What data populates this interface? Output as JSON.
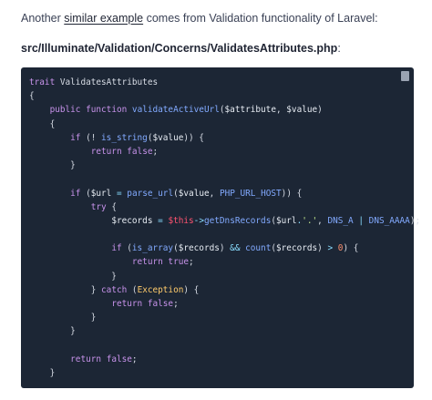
{
  "intro": {
    "before": "Another ",
    "link": "similar example",
    "after": " comes from Validation functionality of Laravel:"
  },
  "file": {
    "path": "src/Illuminate/Validation/Concerns/ValidatesAttributes.php",
    "suffix": ":"
  },
  "code": {
    "lines": [
      [
        [
          "kw",
          "trait"
        ],
        [
          "txt",
          " ValidatesAttributes"
        ]
      ],
      [
        [
          "txt",
          "{"
        ]
      ],
      [
        [
          "txt",
          "    "
        ],
        [
          "kw",
          "public"
        ],
        [
          "txt",
          " "
        ],
        [
          "kw",
          "function"
        ],
        [
          "txt",
          " "
        ],
        [
          "fn",
          "validateActiveUrl"
        ],
        [
          "txt",
          "("
        ],
        [
          "var",
          "$attribute"
        ],
        [
          "txt",
          ", "
        ],
        [
          "var",
          "$value"
        ],
        [
          "txt",
          ")"
        ]
      ],
      [
        [
          "txt",
          "    {"
        ]
      ],
      [
        [
          "txt",
          "        "
        ],
        [
          "kw",
          "if"
        ],
        [
          "txt",
          " (! "
        ],
        [
          "fn",
          "is_string"
        ],
        [
          "txt",
          "("
        ],
        [
          "var",
          "$value"
        ],
        [
          "txt",
          ")) {"
        ]
      ],
      [
        [
          "txt",
          "            "
        ],
        [
          "kw",
          "return"
        ],
        [
          "txt",
          " "
        ],
        [
          "kw",
          "false"
        ],
        [
          "txt",
          ";"
        ]
      ],
      [
        [
          "txt",
          "        }"
        ]
      ],
      [
        [
          "txt",
          ""
        ]
      ],
      [
        [
          "txt",
          "        "
        ],
        [
          "kw",
          "if"
        ],
        [
          "txt",
          " ("
        ],
        [
          "var",
          "$url"
        ],
        [
          "txt",
          " "
        ],
        [
          "op",
          "="
        ],
        [
          "txt",
          " "
        ],
        [
          "fn",
          "parse_url"
        ],
        [
          "txt",
          "("
        ],
        [
          "var",
          "$value"
        ],
        [
          "txt",
          ", "
        ],
        [
          "const",
          "PHP_URL_HOST"
        ],
        [
          "txt",
          ")) {"
        ]
      ],
      [
        [
          "txt",
          "            "
        ],
        [
          "kw",
          "try"
        ],
        [
          "txt",
          " {"
        ]
      ],
      [
        [
          "txt",
          "                "
        ],
        [
          "var",
          "$records"
        ],
        [
          "txt",
          " "
        ],
        [
          "op",
          "="
        ],
        [
          "txt",
          " "
        ],
        [
          "self",
          "$this"
        ],
        [
          "op",
          "->"
        ],
        [
          "fn",
          "getDnsRecords"
        ],
        [
          "txt",
          "("
        ],
        [
          "var",
          "$url"
        ],
        [
          "op",
          "."
        ],
        [
          "str",
          "'.'"
        ],
        [
          "txt",
          ", "
        ],
        [
          "const",
          "DNS_A"
        ],
        [
          "txt",
          " "
        ],
        [
          "op",
          "|"
        ],
        [
          "txt",
          " "
        ],
        [
          "const",
          "DNS_AAAA"
        ],
        [
          "txt",
          ");"
        ]
      ],
      [
        [
          "txt",
          ""
        ]
      ],
      [
        [
          "txt",
          "                "
        ],
        [
          "kw",
          "if"
        ],
        [
          "txt",
          " ("
        ],
        [
          "fn",
          "is_array"
        ],
        [
          "txt",
          "("
        ],
        [
          "var",
          "$records"
        ],
        [
          "txt",
          ") "
        ],
        [
          "op",
          "&&"
        ],
        [
          "txt",
          " "
        ],
        [
          "fn",
          "count"
        ],
        [
          "txt",
          "("
        ],
        [
          "var",
          "$records"
        ],
        [
          "txt",
          ") "
        ],
        [
          "op",
          ">"
        ],
        [
          "txt",
          " "
        ],
        [
          "num",
          "0"
        ],
        [
          "txt",
          ") {"
        ]
      ],
      [
        [
          "txt",
          "                    "
        ],
        [
          "kw",
          "return"
        ],
        [
          "txt",
          " "
        ],
        [
          "kw",
          "true"
        ],
        [
          "txt",
          ";"
        ]
      ],
      [
        [
          "txt",
          "                }"
        ]
      ],
      [
        [
          "txt",
          "            } "
        ],
        [
          "kw",
          "catch"
        ],
        [
          "txt",
          " ("
        ],
        [
          "cls",
          "Exception"
        ],
        [
          "txt",
          ") {"
        ]
      ],
      [
        [
          "txt",
          "                "
        ],
        [
          "kw",
          "return"
        ],
        [
          "txt",
          " "
        ],
        [
          "kw",
          "false"
        ],
        [
          "txt",
          ";"
        ]
      ],
      [
        [
          "txt",
          "            }"
        ]
      ],
      [
        [
          "txt",
          "        }"
        ]
      ],
      [
        [
          "txt",
          ""
        ]
      ],
      [
        [
          "txt",
          "        "
        ],
        [
          "kw",
          "return"
        ],
        [
          "txt",
          " "
        ],
        [
          "kw",
          "false"
        ],
        [
          "txt",
          ";"
        ]
      ],
      [
        [
          "txt",
          "    }"
        ]
      ]
    ]
  },
  "colors": {
    "code_background": "#1c2635",
    "keyword": "#c792ea",
    "function": "#82aaff",
    "string": "#c3e88d",
    "this": "#ff5370",
    "class": "#ffcb6b",
    "number": "#f78c6c"
  },
  "icons": {
    "copy": "copy-icon"
  }
}
